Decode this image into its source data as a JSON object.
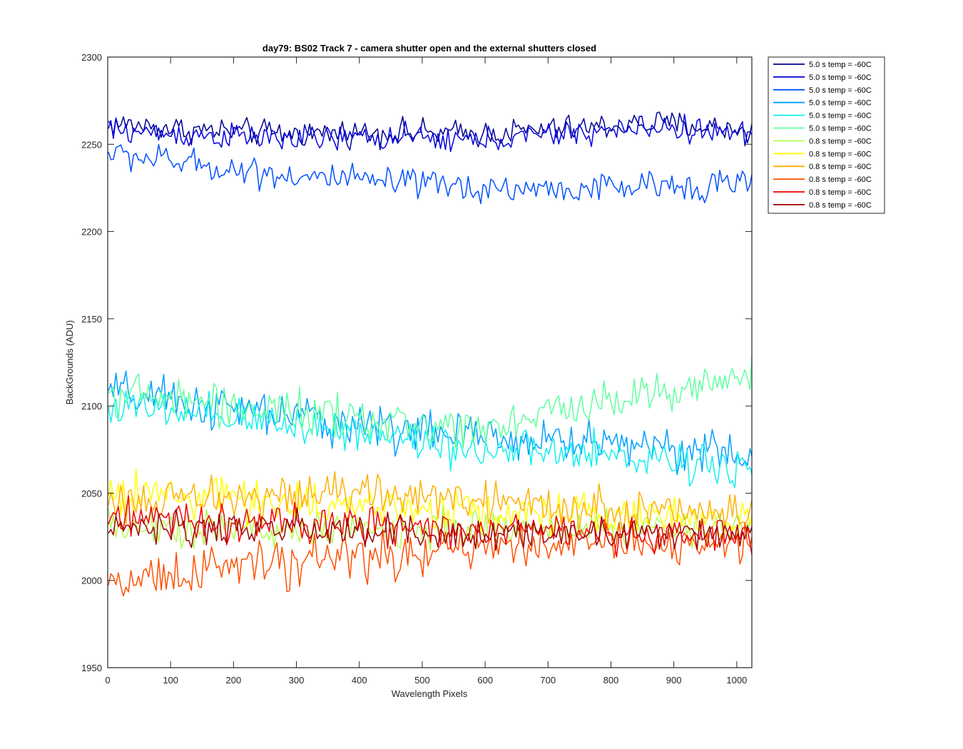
{
  "chart_data": {
    "type": "line",
    "title": "day79: BS02  Track 7 - camera shutter open and the external shutters closed",
    "xlabel": "Wavelength Pixels",
    "ylabel": "BackGrounds (ADU)",
    "xlim": [
      0,
      1024
    ],
    "ylim": [
      1950,
      2300
    ],
    "xticks": [
      0,
      100,
      200,
      300,
      400,
      500,
      600,
      700,
      800,
      900,
      1000
    ],
    "yticks": [
      1950,
      2000,
      2050,
      2100,
      2150,
      2200,
      2250,
      2300
    ],
    "grid": false,
    "legend_position": "outside-top-right",
    "x": {
      "start": 1,
      "end": 1024,
      "step": 4
    },
    "series": [
      {
        "name": "5.0 s temp = -60C",
        "color": "#00008f",
        "mean": [
          2262,
          2258,
          2256,
          2257,
          2256,
          2259,
          2262,
          2258
        ],
        "noise": 7
      },
      {
        "name": "5.0 s temp = -60C",
        "color": "#0000df",
        "mean": [
          2258,
          2255,
          2253,
          2254,
          2252,
          2256,
          2260,
          2255
        ],
        "noise": 7
      },
      {
        "name": "5.0 s temp = -60C",
        "color": "#0050ff",
        "mean": [
          2245,
          2238,
          2232,
          2228,
          2225,
          2224,
          2226,
          2228
        ],
        "noise": 8
      },
      {
        "name": "5.0 s temp = -60C",
        "color": "#00a0ff",
        "mean": [
          2108,
          2100,
          2094,
          2088,
          2082,
          2080,
          2078,
          2070
        ],
        "noise": 12
      },
      {
        "name": "5.0 s temp = -60C",
        "color": "#10f0ef",
        "mean": [
          2100,
          2094,
          2090,
          2084,
          2075,
          2072,
          2070,
          2065
        ],
        "noise": 11
      },
      {
        "name": "5.0 s temp = -60C",
        "color": "#60ffa0",
        "mean": [
          2108,
          2102,
          2096,
          2090,
          2088,
          2098,
          2110,
          2115
        ],
        "noise": 11
      },
      {
        "name": "0.8 s temp = -60C",
        "color": "#b0ff50",
        "mean": [
          2032,
          2030,
          2028,
          2029,
          2030,
          2031,
          2030,
          2030
        ],
        "noise": 10
      },
      {
        "name": "0.8 s temp = -60C",
        "color": "#ffff00",
        "mean": [
          2050,
          2048,
          2045,
          2042,
          2040,
          2038,
          2036,
          2035
        ],
        "noise": 11
      },
      {
        "name": "0.8 s temp = -60C",
        "color": "#ffb000",
        "mean": [
          2045,
          2046,
          2048,
          2050,
          2045,
          2042,
          2040,
          2038
        ],
        "noise": 11
      },
      {
        "name": "0.8 s temp = -60C",
        "color": "#ff5000",
        "mean": [
          2000,
          2005,
          2010,
          2015,
          2018,
          2020,
          2020,
          2022
        ],
        "noise": 12
      },
      {
        "name": "0.8 s temp = -60C",
        "color": "#ef0000",
        "mean": [
          2035,
          2034,
          2032,
          2030,
          2028,
          2028,
          2027,
          2028
        ],
        "noise": 10
      },
      {
        "name": "0.8 s temp = -60C",
        "color": "#a00000",
        "mean": [
          2030,
          2030,
          2029,
          2027,
          2026,
          2026,
          2027,
          2028
        ],
        "noise": 9
      }
    ]
  }
}
